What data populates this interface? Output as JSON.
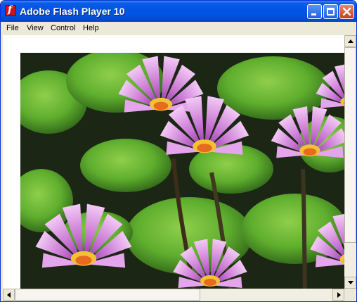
{
  "window": {
    "title": "Adobe Flash Player 10",
    "icon": "flash-player-icon",
    "controls": {
      "minimize": "minimize-icon",
      "maximize": "maximize-icon",
      "close": "close-icon"
    }
  },
  "menubar": {
    "items": [
      "File",
      "View",
      "Control",
      "Help"
    ]
  },
  "content": {
    "image": "water-lilies-photo"
  },
  "colors": {
    "titlebar": "#0054e3",
    "menubar": "#ece9d8",
    "close_button": "#c73e1a"
  }
}
